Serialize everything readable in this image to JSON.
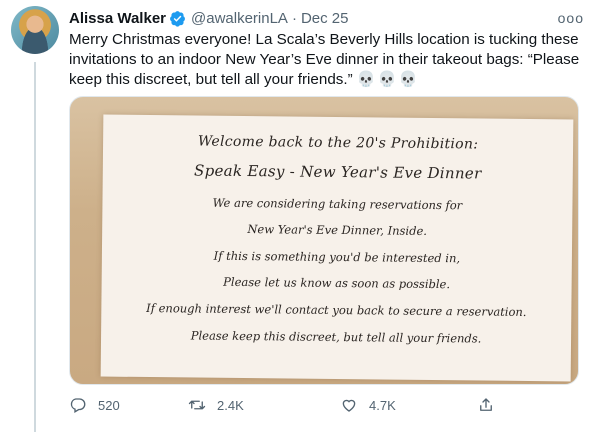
{
  "author": {
    "name": "Alissa Walker",
    "handle": "@awalkerinLA",
    "separator": "·",
    "date": "Dec 25"
  },
  "more_label": "ooo",
  "tweet": {
    "text": "Merry Christmas everyone! La Scala’s Beverly Hills location is tucking these invitations to an indoor New Year’s Eve dinner in their takeout bags: “Please keep this discreet, but tell all your friends.”",
    "emoji": "💀💀💀"
  },
  "invitation": {
    "line1": "Welcome back to the 20's Prohibition:",
    "line2": "Speak Easy - New Year's Eve Dinner",
    "line3": "We are considering taking reservations for",
    "line4": "New Year's Eve Dinner, Inside.",
    "line5": "If this is something you'd be interested in,",
    "line6": "Please let us know as soon as possible.",
    "line7": "If enough interest we'll contact you back to secure a reservation.",
    "line8": "Please keep this discreet, but tell all your friends."
  },
  "actions": {
    "reply_count": "520",
    "retweet_count": "2.4K",
    "like_count": "4.7K"
  },
  "colors": {
    "verified": "#1d9bf0",
    "text": "#0f1419",
    "muted": "#536471"
  }
}
